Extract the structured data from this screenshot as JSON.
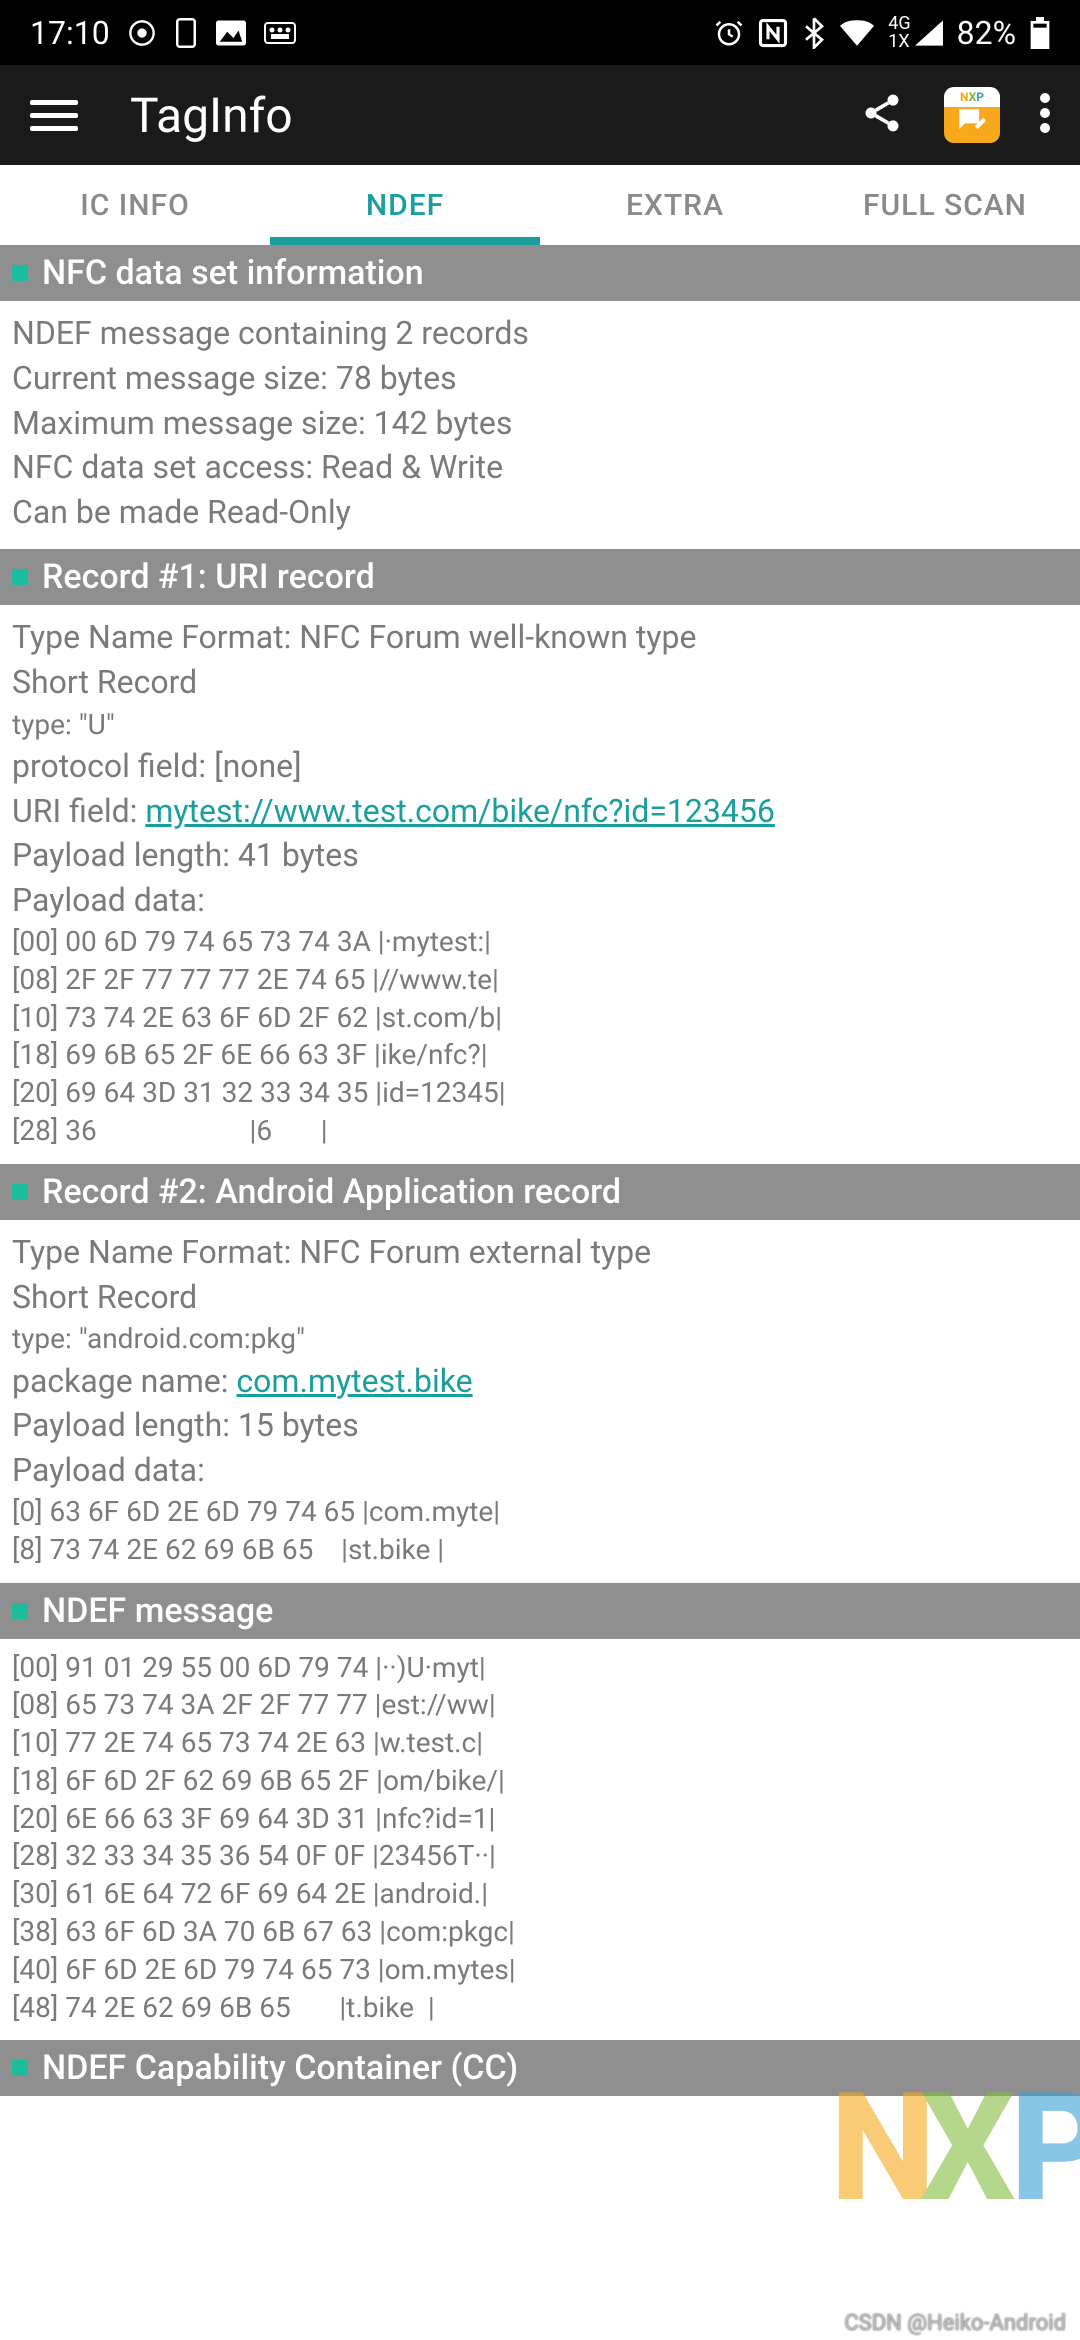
{
  "status": {
    "time": "17:10",
    "battery": "82%"
  },
  "appbar": {
    "title": "TagInfo"
  },
  "tabs": {
    "items": [
      "IC INFO",
      "NDEF",
      "EXTRA",
      "FULL SCAN"
    ],
    "activeIndex": 1
  },
  "sections": {
    "info": {
      "title": "NFC data set information",
      "lines": [
        "NDEF message containing 2 records",
        "Current message size: 78 bytes",
        "Maximum message size: 142 bytes",
        "NFC data set access: Read & Write",
        "Can be made Read-Only"
      ]
    },
    "rec1": {
      "title": "Record #1: URI record",
      "tnf": "Type Name Format: NFC Forum well-known type",
      "short": "Short Record",
      "type": "type: \"U\"",
      "protocol": "protocol field: [none]",
      "uri_label": "URI field: ",
      "uri_link": "mytest://www.test.com/bike/nfc?id=123456",
      "payload_len": "Payload length: 41 bytes",
      "payload_label": "Payload data:",
      "dump": [
        "[00] 00 6D 79 74 65 73 74 3A |·mytest:|",
        "[08] 2F 2F 77 77 77 2E 74 65 |//www.te|",
        "[10] 73 74 2E 63 6F 6D 2F 62 |st.com/b|",
        "[18] 69 6B 65 2F 6E 66 63 3F |ike/nfc?|",
        "[20] 69 64 3D 31 32 33 34 35 |id=12345|",
        "[28] 36                      |6       |"
      ]
    },
    "rec2": {
      "title": "Record #2: Android Application record",
      "tnf": "Type Name Format: NFC Forum external type",
      "short": "Short Record",
      "type": "type: \"android.com:pkg\"",
      "pkg_label": "package name: ",
      "pkg_link": "com.mytest.bike",
      "payload_len": "Payload length: 15 bytes",
      "payload_label": "Payload data:",
      "dump": [
        "[0] 63 6F 6D 2E 6D 79 74 65 |com.myte|",
        "[8] 73 74 2E 62 69 6B 65    |st.bike |"
      ]
    },
    "msg": {
      "title": "NDEF message",
      "dump": [
        "[00] 91 01 29 55 00 6D 79 74 |··)U·myt|",
        "[08] 65 73 74 3A 2F 2F 77 77 |est://ww|",
        "[10] 77 2E 74 65 73 74 2E 63 |w.test.c|",
        "[18] 6F 6D 2F 62 69 6B 65 2F |om/bike/|",
        "[20] 6E 66 63 3F 69 64 3D 31 |nfc?id=1|",
        "[28] 32 33 34 35 36 54 0F 0F |23456T··|",
        "[30] 61 6E 64 72 6F 69 64 2E |android.|",
        "[38] 63 6F 6D 3A 70 6B 67 63 |com:pkgc|",
        "[40] 6F 6D 2E 6D 79 74 65 73 |om.mytes|",
        "[48] 74 2E 62 69 6B 65       |t.bike  |"
      ]
    },
    "cc": {
      "title": "NDEF Capability Container (CC)"
    }
  },
  "watermark": "CSDN @Heiko-Android"
}
